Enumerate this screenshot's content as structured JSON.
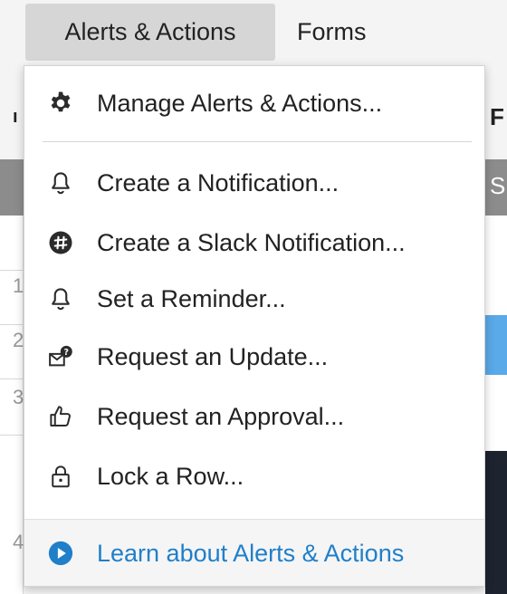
{
  "menubar": {
    "items": [
      {
        "label": "Alerts & Actions"
      },
      {
        "label": "Forms"
      }
    ]
  },
  "background": {
    "row_numbers": [
      "1",
      "2",
      "3",
      "4"
    ],
    "edge_chars": [
      "F",
      "S"
    ]
  },
  "dropdown": {
    "items": [
      {
        "label": "Manage Alerts & Actions...",
        "icon": "gear-icon"
      },
      {
        "label": "Create a Notification...",
        "icon": "bell-icon"
      },
      {
        "label": "Create a Slack Notification...",
        "icon": "slack-icon"
      },
      {
        "label": "Set a Reminder...",
        "icon": "bell-icon"
      },
      {
        "label": "Request an Update...",
        "icon": "envelope-question-icon"
      },
      {
        "label": "Request an Approval...",
        "icon": "thumbs-up-icon"
      },
      {
        "label": "Lock a Row...",
        "icon": "lock-icon"
      }
    ],
    "footer": {
      "label": "Learn about Alerts & Actions",
      "icon": "play-circle-icon"
    }
  },
  "colors": {
    "accent": "#1f7fc9",
    "menubar_active": "#d6d6d6",
    "header_gray": "#8c8c8c",
    "row_selected": "#5aa9e8"
  }
}
